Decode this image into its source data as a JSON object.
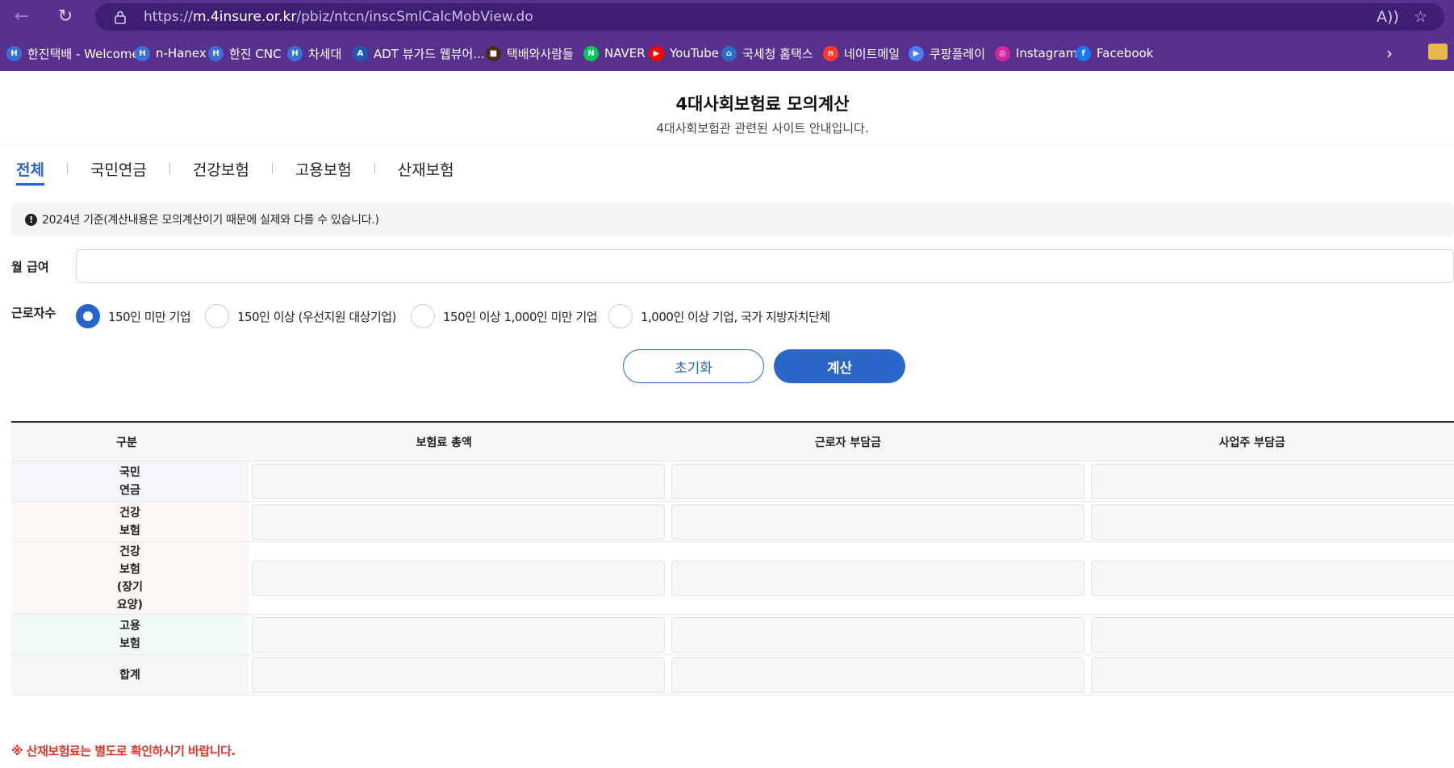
{
  "browser": {
    "url_prefix": "https://",
    "url_host": "m.4insure.or.kr",
    "url_path": "/pbiz/ntcn/inscSmlCalcMobView.do",
    "read_aloud_icon": "A))",
    "bookmarks": [
      {
        "label": "한진택배 - Welcome",
        "icon": "hanjin-icon",
        "color": "#3a6fd8"
      },
      {
        "label": "n-Hanex",
        "icon": "hanjin-icon",
        "color": "#3a6fd8"
      },
      {
        "label": "한진 CNC",
        "icon": "hanjin-icon",
        "color": "#3a6fd8"
      },
      {
        "label": "차세대",
        "icon": "hanjin-icon",
        "color": "#3a6fd8"
      },
      {
        "label": "ADT 뷰가드 웹뷰어...",
        "icon": "adt-icon",
        "color": "#1d5bb8"
      },
      {
        "label": "택배와사람들",
        "icon": "box-icon",
        "color": "#4a2b1a"
      },
      {
        "label": "NAVER",
        "icon": "naver-icon",
        "color": "#03c75a"
      },
      {
        "label": "YouTube",
        "icon": "youtube-icon",
        "color": "#ff0000"
      },
      {
        "label": "국세청 홈택스",
        "icon": "hometax-icon",
        "color": "#2b6cc4"
      },
      {
        "label": "네이트메일",
        "icon": "nate-icon",
        "color": "#ff3b30"
      },
      {
        "label": "쿠팡플레이",
        "icon": "coupang-play-icon",
        "color": "#4a7cff"
      },
      {
        "label": "Instagram",
        "icon": "instagram-icon",
        "color": "#d6249f"
      },
      {
        "label": "Facebook",
        "icon": "facebook-icon",
        "color": "#1877f2"
      }
    ]
  },
  "page": {
    "title": "4대사회보험료 모의계산",
    "subtitle": "4대사회보험관 관련된 사이트 안내입니다.",
    "tabs": [
      "전체",
      "국민연금",
      "건강보험",
      "고용보험",
      "산재보험"
    ],
    "notice": "2024년 기준(계산내용은 모의계산이기 때문에 실제와 다를 수 있습니다.)",
    "salary_label": "월 급여",
    "salary_value": "",
    "workers_label": "근로자수",
    "worker_options": [
      "150인 미만 기업",
      "150인 이상 (우선지원 대상기업)",
      "150인 이상 1,000인 미만 기업",
      "1,000인 이상 기업, 국가 지방자치단체"
    ],
    "reset_label": "초기화",
    "calc_label": "계산",
    "table": {
      "headers": [
        "구분",
        "보험료 총액",
        "근로자 부담금",
        "사업주 부담금"
      ],
      "rows": [
        {
          "label": "국민\n연금",
          "bg": "#f5f6fb"
        },
        {
          "label": "건강\n보험",
          "bg": "#fcf6f4"
        },
        {
          "label": "건강\n보험\n(장기\n요양)",
          "bg": "#fcf6f4"
        },
        {
          "label": "고용\n보험",
          "bg": "#f2faf6"
        },
        {
          "label": "합계",
          "bg": "#f6f6f6"
        }
      ]
    },
    "bottom_note": "※ 산재보험료는 별도로 확인하시기 바랍니다."
  }
}
